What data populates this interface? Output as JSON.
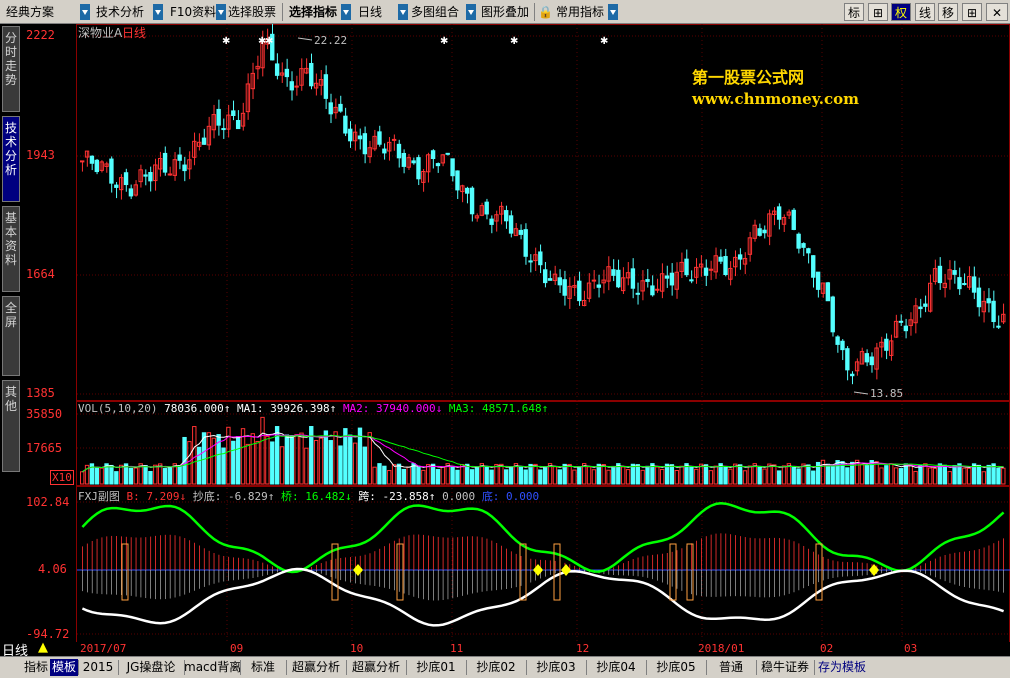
{
  "menu": {
    "items": [
      {
        "label": "经典方案"
      },
      {
        "label": "技术分析"
      },
      {
        "label": "F10资料"
      },
      {
        "label": "选择股票"
      },
      {
        "label": "选择指标"
      },
      {
        "label": "日线"
      },
      {
        "label": "多图组合"
      },
      {
        "label": "图形叠加"
      },
      {
        "label": "常用指标"
      }
    ],
    "right": [
      "标",
      "⊞",
      "权",
      "线",
      "移",
      "⊞"
    ]
  },
  "left_tabs": [
    "分时走势",
    "技术分析",
    "基本资料",
    "全屏",
    "其他"
  ],
  "stock": {
    "title": "深物业A",
    "period": "日线"
  },
  "watermark": {
    "line1": "第一股票公式网",
    "line2": "www.chnmoney.com"
  },
  "price_axis": [
    "2222",
    "1943",
    "1664",
    "1385"
  ],
  "price_annotations": {
    "high": "22.22",
    "low": "13.85"
  },
  "volume": {
    "title": "VOL(5,10,20)",
    "value": "78036.000↑",
    "ma1": "MA1: 39926.398↑",
    "ma2": "MA2: 37940.000↓",
    "ma3": "MA3: 48571.648↑",
    "axis": [
      "35850",
      "17665",
      "X10"
    ]
  },
  "indicator": {
    "name": "FXJ副图",
    "b": "B: 7.209↓",
    "chaodi": "抄底: -6.829↑",
    "qiao": "桥: 16.482↓",
    "kua": "跨: -23.858↑",
    "zero": "0.000",
    "di": "底: 0.000",
    "axis": [
      "102.84",
      "4.06",
      "-94.72"
    ]
  },
  "date_axis": [
    "2017/07",
    "09",
    "10",
    "11",
    "12",
    "2018/01",
    "02",
    "03"
  ],
  "period_label": "日线",
  "bottom_tabs": [
    "指标",
    "模板",
    "2015",
    "JG操盘论",
    "macd背离",
    "标准",
    "超赢分析",
    "超赢分析",
    "抄底01",
    "抄底02",
    "抄底03",
    "抄底04",
    "抄底05",
    "普通",
    "稳牛证券",
    "存为模板"
  ],
  "chart_data": {
    "type": "candlestick",
    "price_range": [
      13.85,
      22.22
    ],
    "high": 22.22,
    "low": 13.85,
    "close_path": [
      19.3,
      19.0,
      18.8,
      18.9,
      19.2,
      19.6,
      20.1,
      20.4,
      22.0,
      21.1,
      21.5,
      20.5,
      20.0,
      19.6,
      19.5,
      19.2,
      19.3,
      18.6,
      18.0,
      17.8,
      17.2,
      16.3,
      16.2,
      16.6,
      16.4,
      16.5,
      16.4,
      16.7,
      17.0,
      16.6,
      17.8,
      18.1,
      17.3,
      16.4,
      14.2,
      14.8,
      15.2,
      15.5,
      16.8,
      16.4,
      16.1,
      15.6
    ],
    "colors": {
      "up": "#ff3232",
      "down": "#54ffff",
      "ma1": "#ffffff",
      "ma2": "#ff00ff",
      "ma3": "#00ff00",
      "axis": "#ff3232",
      "grid": "#8b0000"
    }
  }
}
